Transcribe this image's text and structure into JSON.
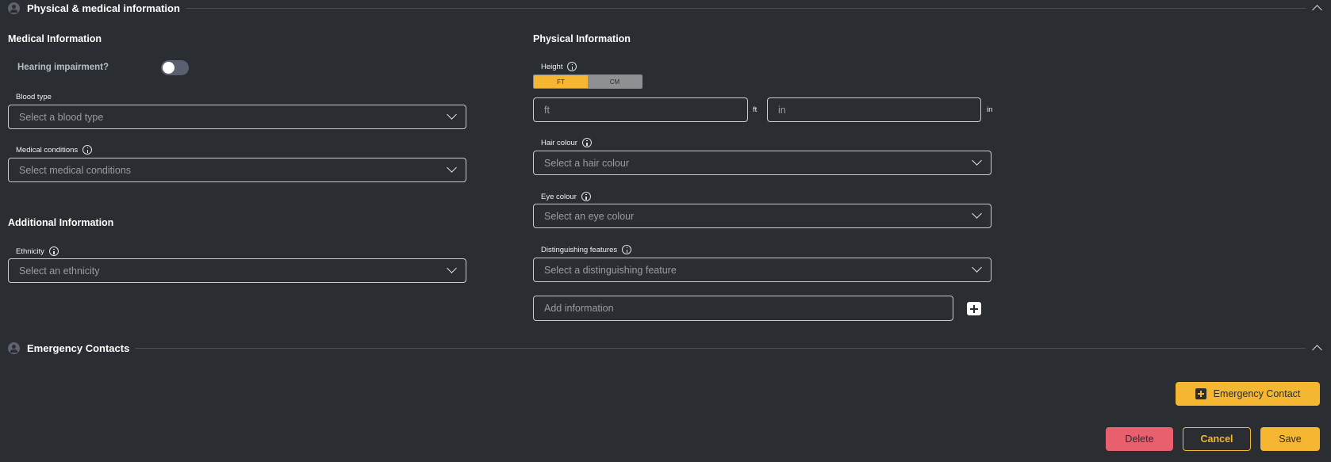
{
  "physical_section": {
    "title": "Physical & medical information",
    "icon": "person-icon"
  },
  "medical": {
    "title": "Medical Information",
    "hearing_label": "Hearing impairment?",
    "hearing_on": false,
    "blood_type_label": "Blood type",
    "blood_type_placeholder": "Select a blood type",
    "conditions_label": "Medical conditions",
    "conditions_placeholder": "Select medical conditions"
  },
  "additional": {
    "title": "Additional Information",
    "ethnicity_label": "Ethnicity",
    "ethnicity_placeholder": "Select an ethnicity"
  },
  "physical": {
    "title": "Physical Information",
    "height_label": "Height",
    "units": [
      "FT",
      "CM"
    ],
    "selected_unit": "FT",
    "ft_placeholder": "ft",
    "ft_suffix": "ft",
    "in_placeholder": "in",
    "in_suffix": "in",
    "hair_label": "Hair colour",
    "hair_placeholder": "Select a hair colour",
    "eye_label": "Eye colour",
    "eye_placeholder": "Select an eye colour",
    "features_label": "Distinguishing features",
    "features_placeholder": "Select a distinguishing feature",
    "add_info_placeholder": "Add information"
  },
  "emergency_section": {
    "title": "Emergency Contacts",
    "add_button": "Emergency Contact"
  },
  "actions": {
    "delete": "Delete",
    "cancel": "Cancel",
    "save": "Save"
  },
  "colors": {
    "background": "#2a2d31",
    "accent": "#f5b731",
    "danger": "#e8606d"
  }
}
